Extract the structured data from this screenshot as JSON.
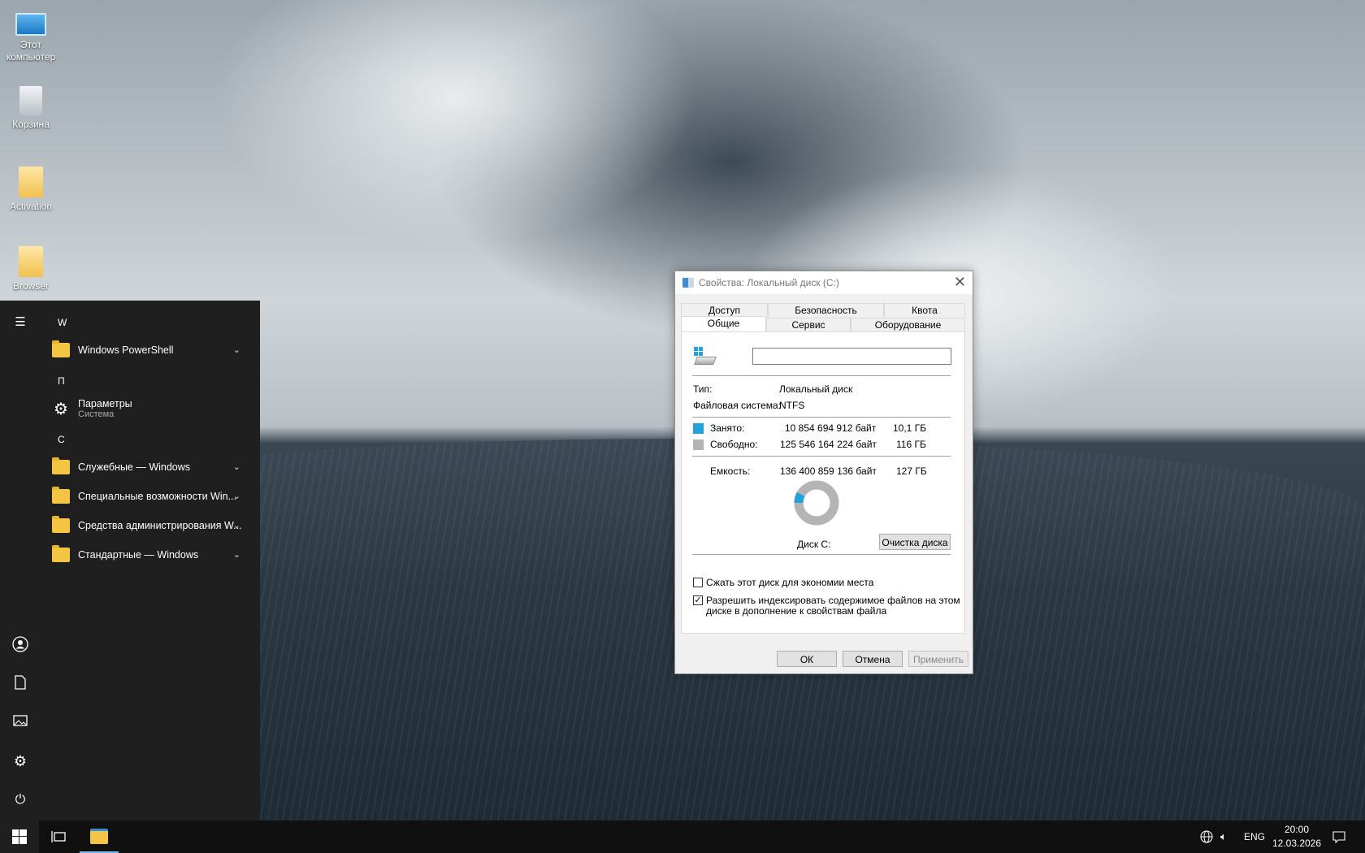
{
  "desktop": {
    "icons": [
      {
        "label": "Этот компьютер",
        "icon": "computer-icon"
      },
      {
        "label": "Корзина",
        "icon": "recycle-bin-icon"
      },
      {
        "label": "Activation",
        "icon": "folder-icon"
      },
      {
        "label": "Browser",
        "icon": "folder-icon"
      }
    ]
  },
  "start_menu": {
    "groups": [
      {
        "letter": "W",
        "apps": [
          {
            "label": "Windows PowerShell",
            "expandable": true
          }
        ]
      },
      {
        "letter": "П",
        "apps": [
          {
            "label": "Параметры",
            "sublabel": "Система",
            "expandable": false
          }
        ]
      },
      {
        "letter": "С",
        "apps": [
          {
            "label": "Служебные — Windows",
            "expandable": true
          },
          {
            "label": "Специальные возможности Win...",
            "expandable": true
          },
          {
            "label": "Средства администрирования W...",
            "expandable": true
          },
          {
            "label": "Стандартные — Windows",
            "expandable": true
          }
        ]
      }
    ],
    "rail_icons": [
      "hamburger-icon",
      "user-icon",
      "documents-icon",
      "pictures-icon",
      "settings-icon",
      "power-icon"
    ]
  },
  "dialog": {
    "title": "Свойства: Локальный диск (C:)",
    "tabs_row1": [
      "Доступ",
      "Безопасность",
      "Квота"
    ],
    "tabs_row2": [
      "Общие",
      "Сервис",
      "Оборудование"
    ],
    "active_tab": "Общие",
    "name_value": "",
    "type_label": "Тип:",
    "type_value": "Локальный диск",
    "fs_label": "Файловая система:",
    "fs_value": "NTFS",
    "used_label": "Занято:",
    "used_bytes": "10 854 694 912 байт",
    "used_gb": "10,1 ГБ",
    "free_label": "Свободно:",
    "free_bytes": "125 546 164 224 байт",
    "free_gb": "116 ГБ",
    "cap_label": "Емкость:",
    "cap_bytes": "136 400 859 136 байт",
    "cap_gb": "127 ГБ",
    "used_fraction": 0.0796,
    "used_color": "#26a0da",
    "free_color": "#b4b4b4",
    "disk_label": "Диск C:",
    "cleanup_button": "Очистка диска",
    "compress_label": "Сжать этот диск для экономии места",
    "compress_checked": false,
    "index_label_1": "Разрешить индексировать содержимое файлов на этом",
    "index_label_2": "диске в дополнение к свойствам файла",
    "index_checked": true,
    "ok_button": "ОК",
    "cancel_button": "Отмена",
    "apply_button": "Применить"
  },
  "taskbar": {
    "language": "ENG",
    "time": "20:00",
    "date": "12.03.2026"
  }
}
